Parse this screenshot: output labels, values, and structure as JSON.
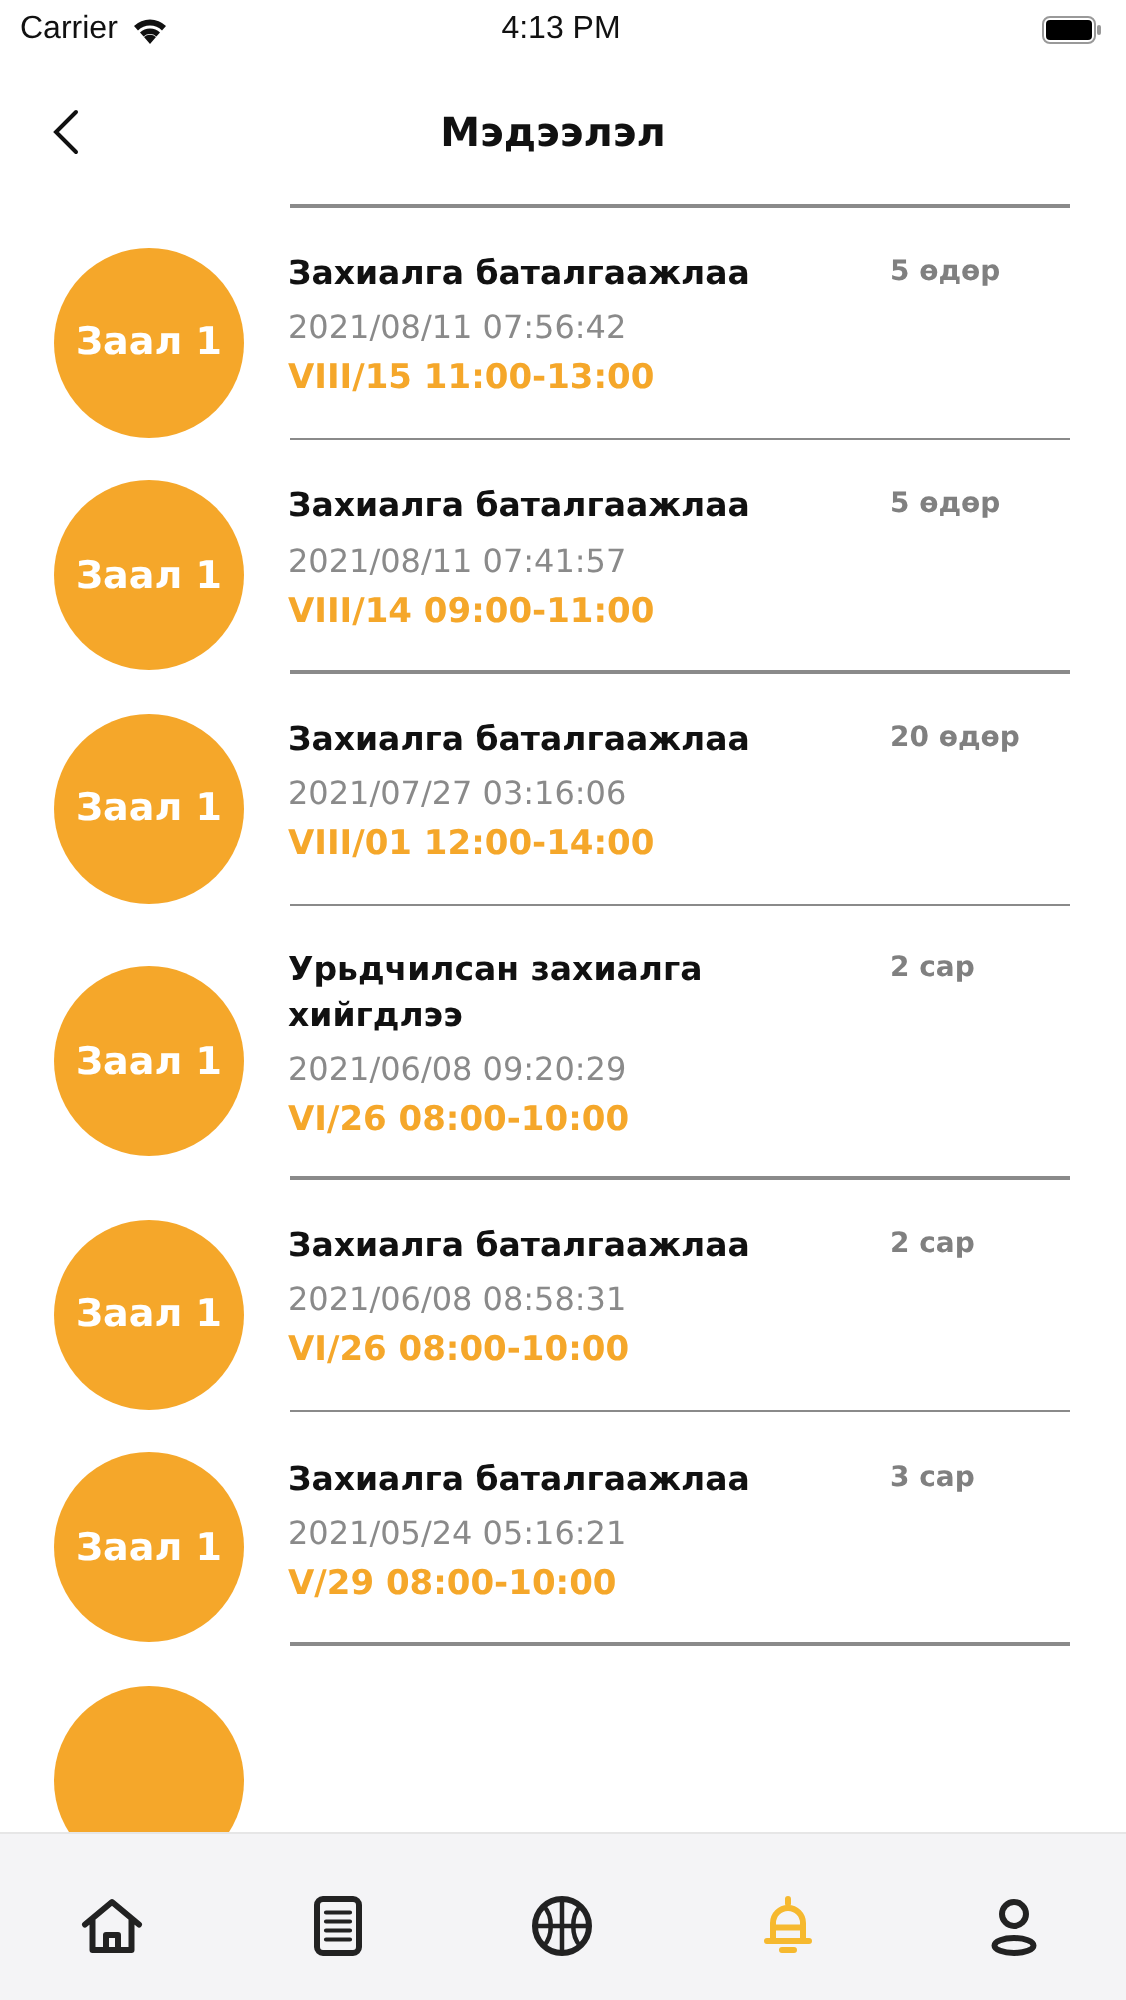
{
  "status_bar": {
    "carrier": "Carrier",
    "time": "4:13 PM"
  },
  "header": {
    "title": "Мэдээлэл"
  },
  "notifications": [
    {
      "kind": "full",
      "badge": "Заал 1",
      "title": "Захиалга баталгаажлаа",
      "age": "5 өдөр",
      "created": "2021/08/11 07:56:42",
      "slot": "VIII/15 11:00-13:00"
    },
    {
      "kind": "full",
      "badge": "Заал 1",
      "title": "Захиалга баталгаажлаа",
      "age": "5 өдөр",
      "created": "2021/08/11 07:41:57",
      "slot": "VIII/14 09:00-11:00"
    },
    {
      "kind": "full",
      "badge": "Заал 1",
      "title": "Захиалга баталгаажлаа",
      "age": "20 өдөр",
      "created": "2021/07/27 03:16:06",
      "slot": "VIII/01 12:00-14:00"
    },
    {
      "kind": "full",
      "badge": "Заал 1",
      "title": "Урьдчилсан захиалга хийгдлээ",
      "age": "2 сар",
      "created": "2021/06/08 09:20:29",
      "slot": "VI/26 08:00-10:00"
    },
    {
      "kind": "full",
      "badge": "Заал 1",
      "title": "Захиалга баталгаажлаа",
      "age": "2 сар",
      "created": "2021/06/08 08:58:31",
      "slot": "VI/26 08:00-10:00"
    },
    {
      "kind": "full",
      "badge": "Заал 1",
      "title": "Захиалга баталгаажлаа",
      "age": "3 сар",
      "created": "2021/05/24 05:16:21",
      "slot": "V/29 08:00-10:00"
    },
    {
      "kind": "partial"
    }
  ],
  "tab_bar": [
    {
      "kind": "home",
      "selected": false
    },
    {
      "kind": "list",
      "selected": false
    },
    {
      "kind": "ball",
      "selected": false
    },
    {
      "kind": "bell",
      "selected": true
    },
    {
      "kind": "user",
      "selected": false
    }
  ]
}
